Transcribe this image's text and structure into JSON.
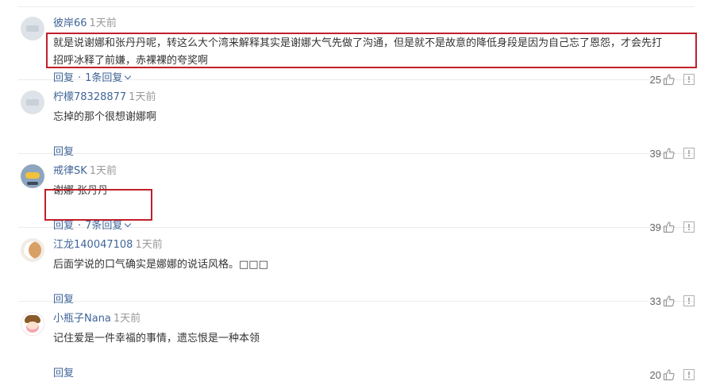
{
  "comments": [
    {
      "user": "彼岸66",
      "time": "1天前",
      "text": "就是说谢娜和张丹丹呢，转这么大个湾来解释其实是谢娜大气先做了沟通，但是就不是故意的降低身段是因为自己忘了恩怨，才会先打招呼冰释了前嫌，赤裸裸的夸奖啊",
      "reply_label": "回复",
      "replies_label": "1条回复",
      "likes": "25"
    },
    {
      "user": "柠檬78328877",
      "time": "1天前",
      "text": "忘掉的那个很想谢娜啊",
      "reply_label": "回复",
      "likes": "39"
    },
    {
      "user": "戒律SK",
      "time": "1天前",
      "text": "谢娜 张丹丹",
      "reply_label": "回复",
      "replies_label": "7条回复",
      "likes": "39"
    },
    {
      "user": "江龙140047108",
      "time": "1天前",
      "text": "后面学说的口气确实是娜娜的说话风格。□□□",
      "reply_label": "回复",
      "likes": "33"
    },
    {
      "user": "小瓶子Nana",
      "time": "1天前",
      "text": "记住爱是一件幸福的事情，遗忘恨是一种本领",
      "reply_label": "回复",
      "likes": "20"
    }
  ],
  "separator": "·",
  "colors": {
    "username": "#406599",
    "text": "#333333",
    "meta": "#999999",
    "highlight": "#c0202b"
  },
  "icons": [
    "avatar",
    "thumbs-up-icon",
    "report-icon",
    "chevron-down-icon"
  ]
}
